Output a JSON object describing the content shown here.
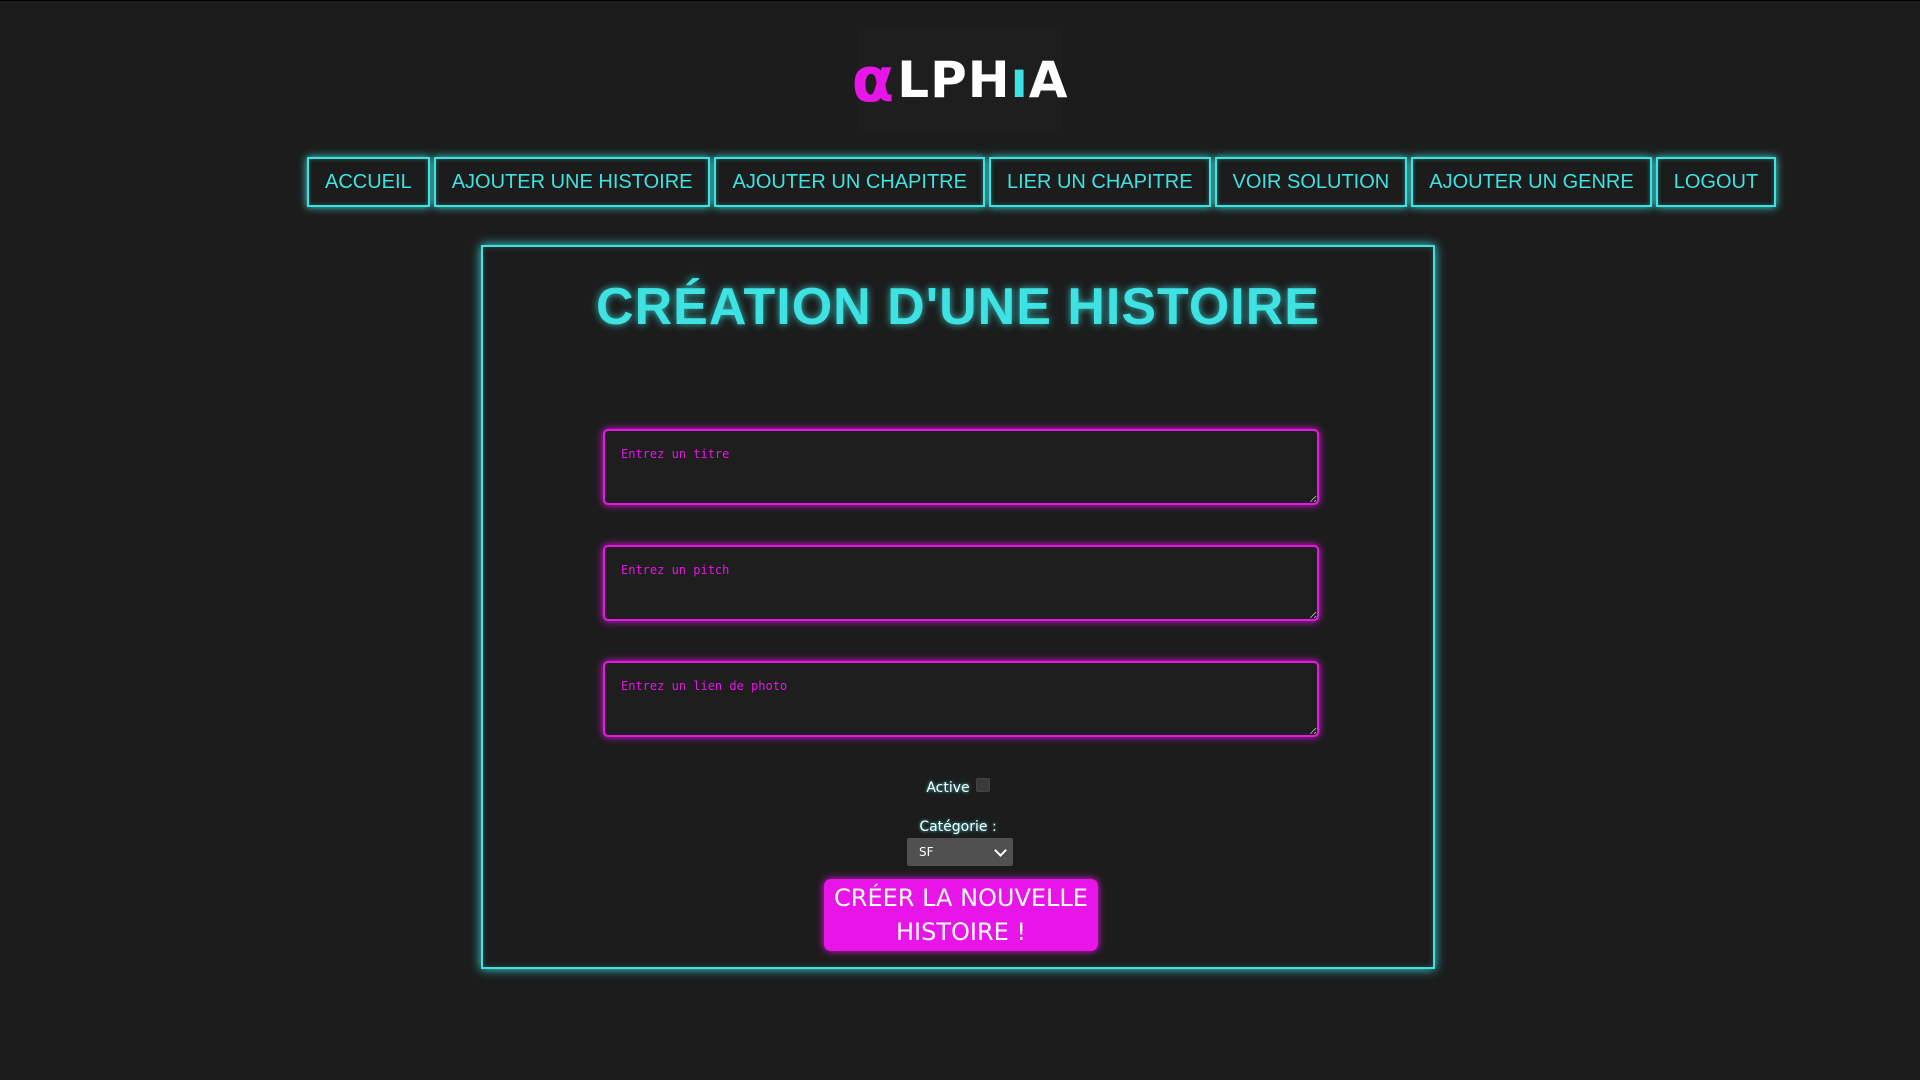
{
  "logo": {
    "text_pre": "α",
    "text_mid": "LPH",
    "text_hook": "ı",
    "text_end": "A"
  },
  "nav": {
    "items": [
      {
        "label": "ACCUEIL"
      },
      {
        "label": "AJOUTER UNE HISTOIRE"
      },
      {
        "label": "AJOUTER UN CHAPITRE"
      },
      {
        "label": "LIER UN CHAPITRE"
      },
      {
        "label": "VOIR SOLUTION"
      },
      {
        "label": "AJOUTER UN GENRE"
      },
      {
        "label": "LOGOUT"
      }
    ]
  },
  "main": {
    "title": "CRÉATION D'UNE HISTOIRE",
    "fields": {
      "title_placeholder": "Entrez un titre",
      "pitch_placeholder": "Entrez un pitch",
      "photo_placeholder": "Entrez un lien de photo"
    },
    "active_label": "Active",
    "active_checked": false,
    "category_label": "Catégorie :",
    "category_selected": "SF",
    "submit_label": "CRÉER LA NOUVELLE HISTOIRE !"
  },
  "colors": {
    "accent_cyan": "#3fe2e2",
    "accent_magenta": "#e715e7",
    "background": "#1c1c1c"
  }
}
